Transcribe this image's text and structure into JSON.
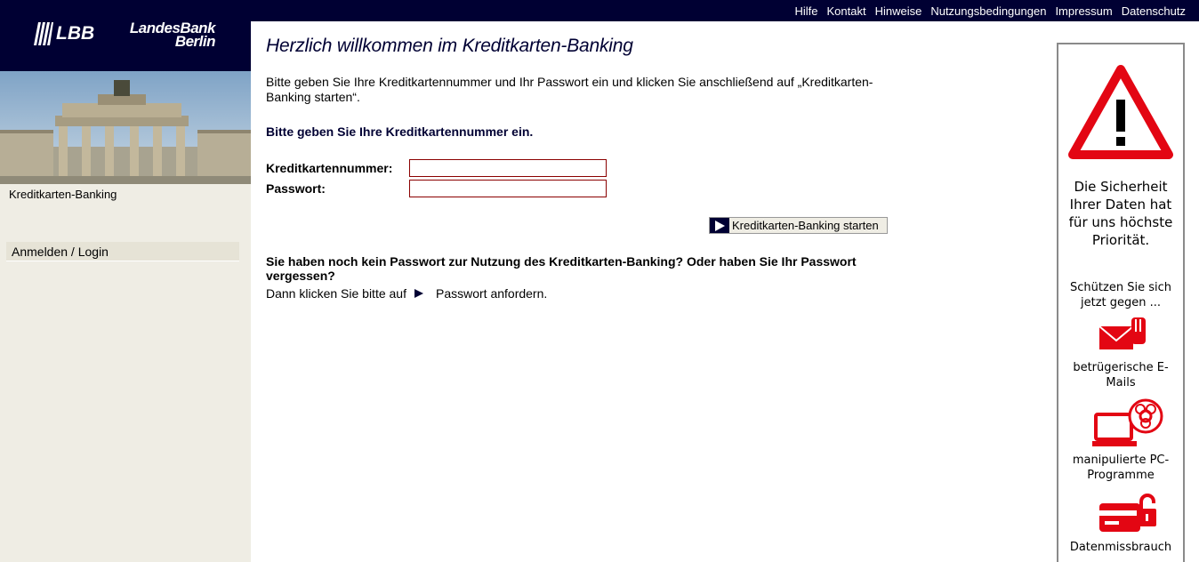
{
  "header": {
    "links": [
      "Hilfe",
      "Kontakt",
      "Hinweise",
      "Nutzungsbedingungen",
      "Impressum",
      "Datenschutz"
    ]
  },
  "brand": {
    "logo_text": "LBB",
    "bank_name_line1": "LandesBank",
    "bank_name_line2": "Berlin"
  },
  "sidebar": {
    "section_label": "Kreditkarten-Banking",
    "nav_items": [
      "Anmelden / Login"
    ]
  },
  "main": {
    "title": "Herzlich willkommen im Kreditkarten-Banking",
    "intro": "Bitte geben Sie Ihre Kreditkartennummer und Ihr Passwort ein und klicken Sie anschließend auf „Kreditkarten-Banking starten“.",
    "subheading": "Bitte geben Sie Ihre Kreditkartennummer ein.",
    "card_label": "Kreditkartennummer:",
    "card_value": "",
    "password_label": "Passwort:",
    "password_value": "",
    "start_button": "Kreditkarten-Banking starten",
    "pw_question": "Sie haben noch kein Passwort zur Nutzung des Kreditkarten-Banking? Oder haben Sie Ihr Passwort vergessen?",
    "pw_prompt": "Dann klicken Sie bitte auf",
    "pw_link": "Passwort anfordern."
  },
  "banner": {
    "headline": "Die Sicherheit Ihrer Daten hat für uns höchste Priorität.",
    "sub": "Schützen Sie sich jetzt gegen ...",
    "items": [
      "betrügerische E-Mails",
      "manipulierte PC-Programme",
      "Datenmissbrauch"
    ],
    "accent_color": "#e30613"
  },
  "colors": {
    "navy": "#000033",
    "sidebar_bg": "#efede4",
    "input_border": "#8b0000"
  }
}
